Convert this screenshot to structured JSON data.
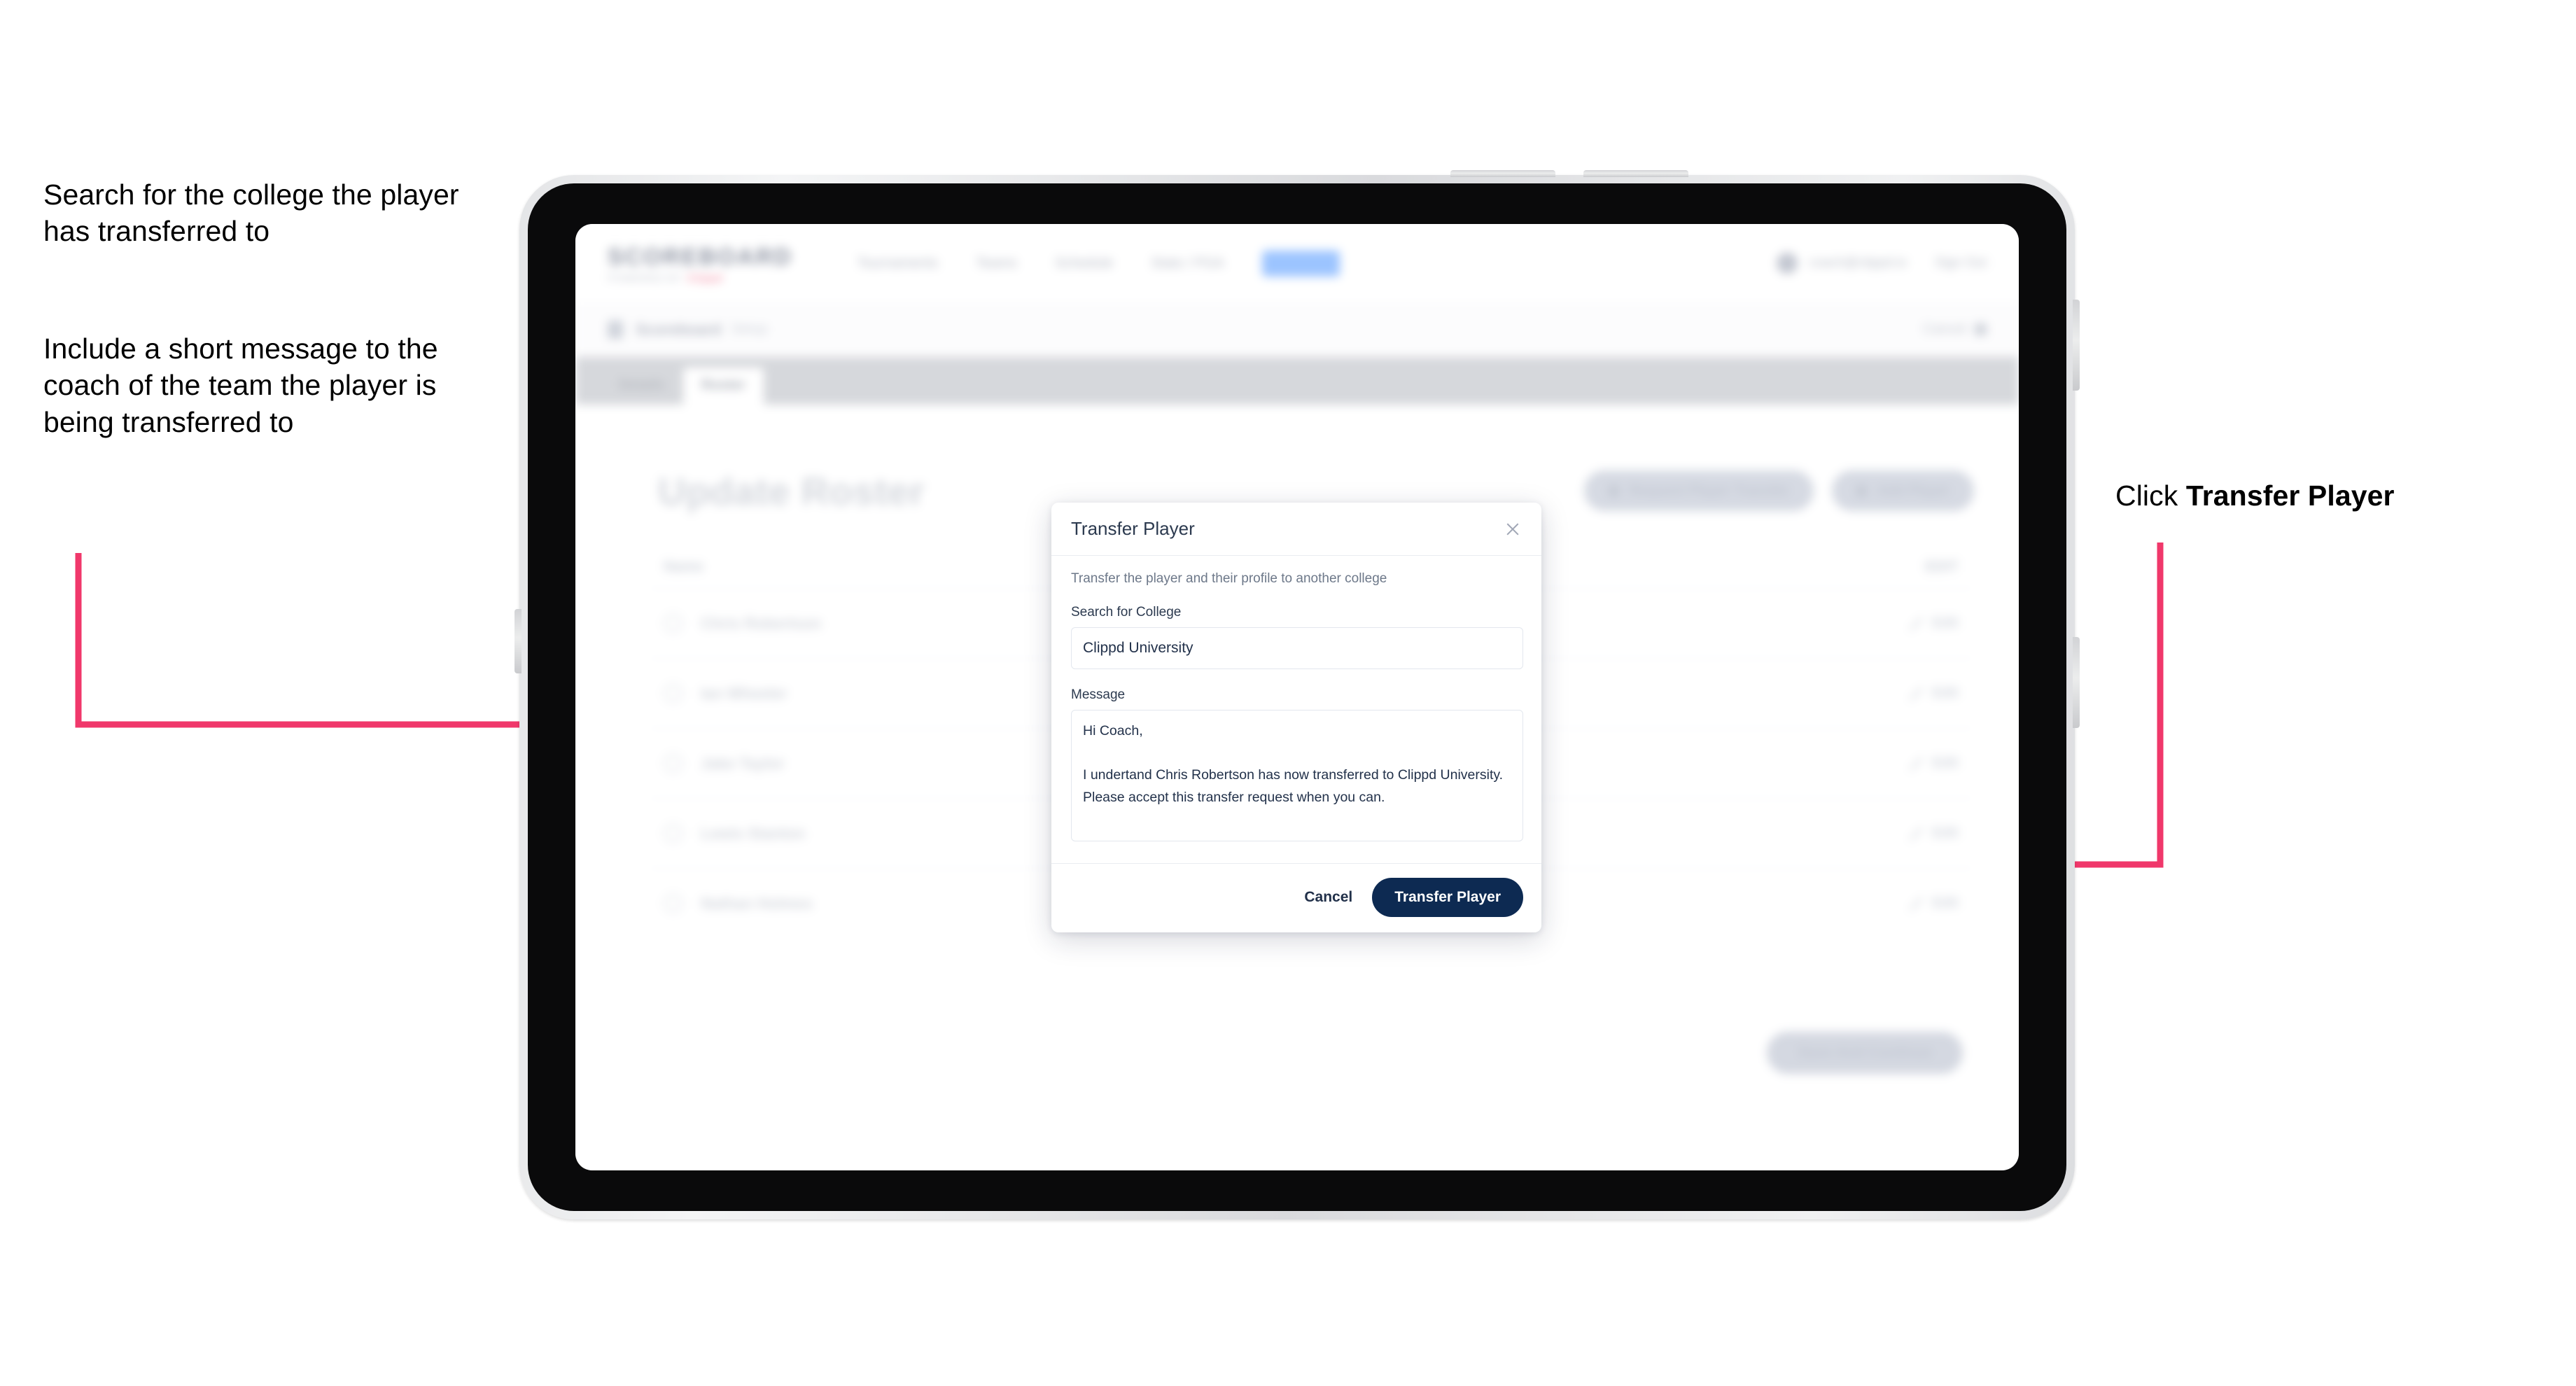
{
  "annotations": {
    "left_note_1": "Search for the college the player has transferred to",
    "left_note_2": "Include a short message to the coach of the team the player is being transferred to",
    "right_note_prefix": "Click ",
    "right_note_bold": "Transfer Player",
    "arrow_color": "#f0386b"
  },
  "app": {
    "logo": {
      "main": "SCOREBOARD",
      "sub": "POWERED BY",
      "sub_accent": "Clippd"
    },
    "nav": [
      {
        "label": "Tournaments"
      },
      {
        "label": "Teams"
      },
      {
        "label": "Schedule"
      },
      {
        "label": "Stats / PGA"
      }
    ],
    "nav_badge": "Roster",
    "user": {
      "email": "coach@clippd.io",
      "signout": "Sign Out",
      "avatar": "user-avatar"
    },
    "breadcrumb": {
      "icon": "clipboard-icon",
      "main": "Scoreboard",
      "sub": "Setup",
      "cancel": "Cancel",
      "cancel_icon": "close-icon"
    },
    "tabs": [
      {
        "label": "Details",
        "active": false
      },
      {
        "label": "Roster",
        "active": true
      }
    ],
    "page_title": "Update Roster",
    "header_actions": [
      {
        "label": "Request Player Transfer",
        "icon": "transfer-icon"
      },
      {
        "label": "Add Player",
        "icon": "plus-icon"
      }
    ],
    "roster": {
      "col_name": "Name",
      "col_action": "EDIT",
      "rows": [
        {
          "name": "Chris Robertson",
          "action": "Edit"
        },
        {
          "name": "Ian Wheeler",
          "action": "Edit"
        },
        {
          "name": "Jake Taylor",
          "action": "Edit"
        },
        {
          "name": "Lewis Stanton",
          "action": "Edit"
        },
        {
          "name": "Nathan Holmes",
          "action": "Edit"
        }
      ]
    },
    "bottom_button": "Save And Continue"
  },
  "modal": {
    "title": "Transfer Player",
    "close_icon": "close-icon",
    "description": "Transfer the player and their profile to another college",
    "college_label": "Search for College",
    "college_value": "Clippd University",
    "college_placeholder": "Search for College",
    "message_label": "Message",
    "message_value": "Hi Coach,\n\nI undertand Chris Robertson has now transferred to Clippd University. Please accept this transfer request when you can.",
    "message_placeholder": "Message",
    "cancel_label": "Cancel",
    "submit_label": "Transfer Player",
    "submit_color": "#0d2a52"
  }
}
